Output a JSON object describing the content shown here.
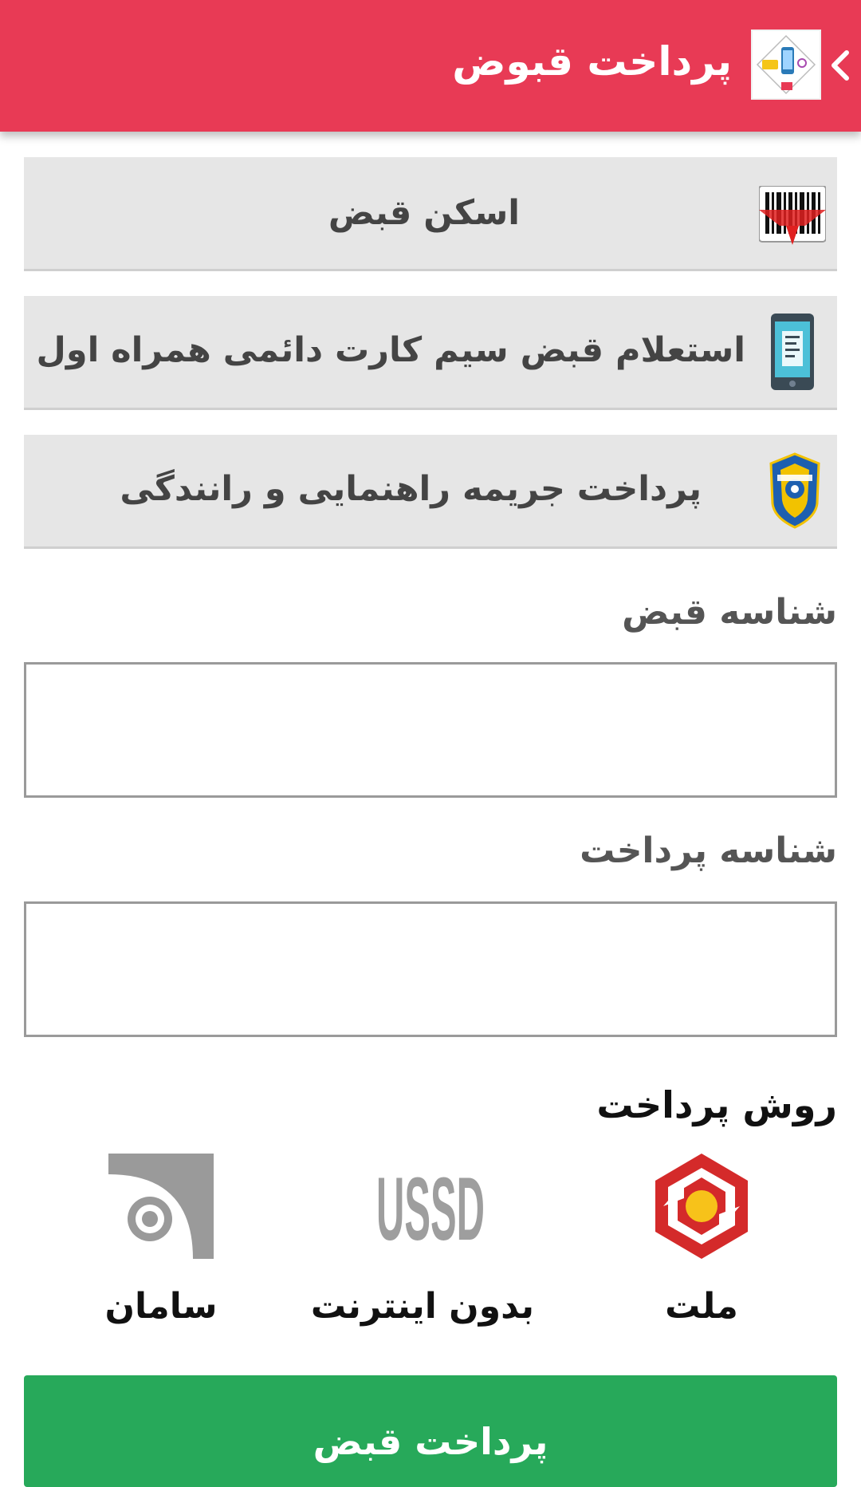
{
  "app_bar": {
    "title": "پرداخت قبوض",
    "back_icon": "chevron-left-icon",
    "app_icon": "bills-app-icon",
    "background": "#e83a55"
  },
  "actions": [
    {
      "label": "اسکن قبض",
      "icon": "barcode-scan-icon"
    },
    {
      "label": "استعلام قبض سیم کارت دائمی همراه اول",
      "icon": "mobile-bill-icon"
    },
    {
      "label": "پرداخت جریمه راهنمایی و رانندگی",
      "icon": "traffic-police-icon"
    }
  ],
  "form": {
    "bill_id_label": "شناسه قبض",
    "bill_id_value": "",
    "payment_id_label": "شناسه پرداخت",
    "payment_id_value": ""
  },
  "payment_method": {
    "title": "روش پرداخت",
    "options": [
      {
        "label": "ملت",
        "logo": "mellat-bank-logo"
      },
      {
        "label": "بدون اینترنت",
        "logo": "ussd-logo",
        "logo_text": "USSD"
      },
      {
        "label": "سامان",
        "logo": "saman-bank-logo"
      }
    ]
  },
  "pay_button": {
    "label": "پرداخت قبض",
    "color": "#27a95a"
  }
}
